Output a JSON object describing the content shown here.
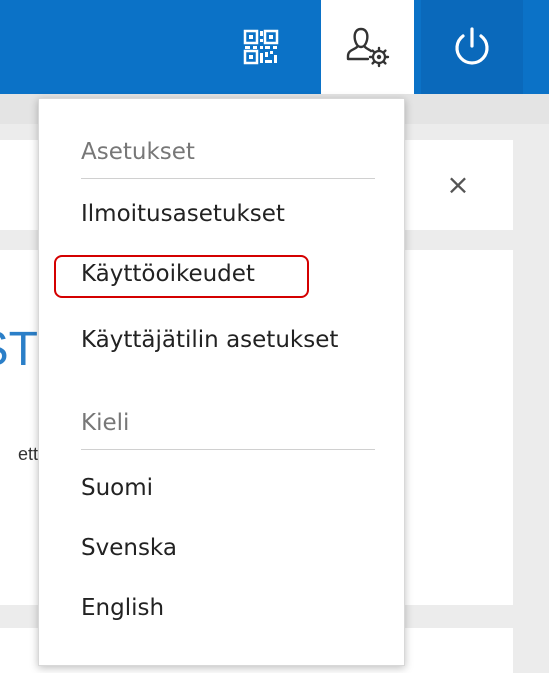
{
  "topbar": {
    "qr_icon": "qr-code-icon",
    "user_settings_icon": "user-settings-icon",
    "power_icon": "power-icon",
    "accent_color": "#0b72c7"
  },
  "background": {
    "close_symbol": "×",
    "large_fragment": "ST",
    "small_fragment": "ett"
  },
  "menu": {
    "settings_heading": "Asetukset",
    "settings_items": [
      "Ilmoitusasetukset",
      "Käyttöoikeudet",
      "Käyttäjätilin asetukset"
    ],
    "language_heading": "Kieli",
    "language_items": [
      "Suomi",
      "Svenska",
      "English"
    ],
    "highlight_color": "#d40000"
  }
}
